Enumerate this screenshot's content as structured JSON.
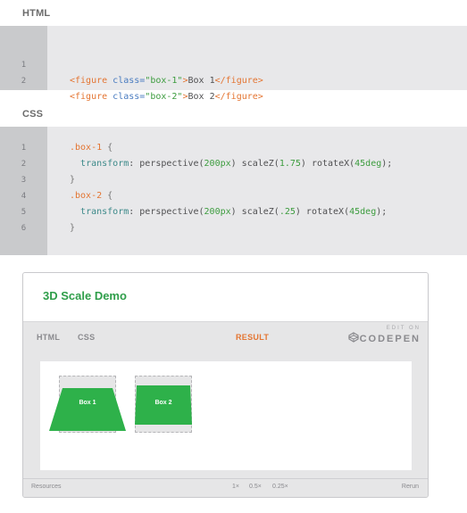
{
  "html_section": {
    "label": "HTML",
    "lines": [
      {
        "n": "1",
        "open_tag": "<figure",
        "attr": " class=",
        "value": "\"box-1\"",
        "close_open": ">",
        "text": "Box 1",
        "end_tag": "</figure>"
      },
      {
        "n": "2",
        "open_tag": "<figure",
        "attr": " class=",
        "value": "\"box-2\"",
        "close_open": ">",
        "text": "Box 2",
        "end_tag": "</figure>"
      }
    ]
  },
  "css_section": {
    "label": "CSS",
    "lines": [
      {
        "n": "1",
        "text": ".box-1 {"
      },
      {
        "n": "2",
        "text": "  transform: perspective(200px) scaleZ(1.75) rotateX(45deg);"
      },
      {
        "n": "3",
        "text": "}"
      },
      {
        "n": "4",
        "text": ".box-2 {"
      },
      {
        "n": "5",
        "text": "  transform: perspective(200px) scaleZ(.25) rotateX(45deg);"
      },
      {
        "n": "6",
        "text": "}"
      }
    ]
  },
  "demo": {
    "title": "3D Scale Demo",
    "tabs": {
      "html": "HTML",
      "css": "CSS",
      "result": "RESULT"
    },
    "brand": {
      "edit_on": "EDIT ON",
      "name": "CODEPEN"
    },
    "boxes": [
      {
        "label": "Box 1"
      },
      {
        "label": "Box 2"
      }
    ],
    "footer": {
      "resources": "Resources",
      "zoom": [
        "1×",
        "0.5×",
        "0.25×"
      ],
      "rerun": "Rerun"
    },
    "colors": {
      "accent_green": "#2eb14a",
      "result_orange": "#e47532"
    }
  }
}
